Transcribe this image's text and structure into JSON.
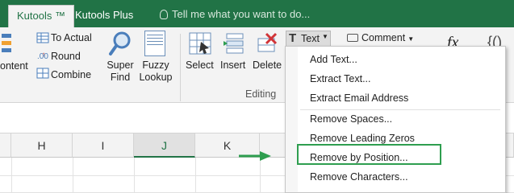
{
  "tabs": [
    {
      "label": "Kutools ™",
      "active": true
    },
    {
      "label": "Kutools Plus",
      "active": false
    }
  ],
  "tell_me": "Tell me what you want to do...",
  "ribbon": {
    "content_partial": "ontent",
    "to_actual": "To Actual",
    "round": "Round",
    "combine": "Combine",
    "super_find": [
      "Super",
      "Find"
    ],
    "fuzzy_lookup": [
      "Fuzzy",
      "Lookup"
    ],
    "select": "Select",
    "insert": "Insert",
    "delete": "Delete",
    "editing_group": "Editing",
    "text_button": "Text",
    "comment_button": "Comment"
  },
  "columns": [
    "H",
    "I",
    "J",
    "K"
  ],
  "selected_column": "J",
  "text_menu": {
    "items": [
      "Add Text...",
      "Extract Text...",
      "Extract Email Address",
      "Remove Spaces...",
      "Remove Leading Zeros",
      "Remove by Position...",
      "Remove Characters..."
    ],
    "highlighted": "Remove by Position..."
  },
  "colors": {
    "tab_bar": "#217346",
    "highlight_border": "#2e9e4f",
    "arrow": "#2e9e4f"
  }
}
